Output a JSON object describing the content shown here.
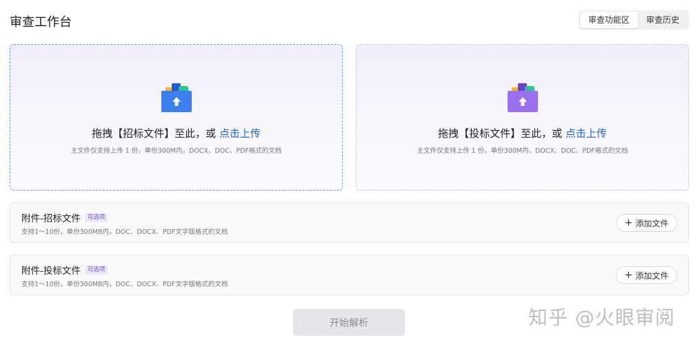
{
  "header": {
    "title": "审查工作台",
    "tabs": [
      {
        "label": "审查功能区",
        "active": true
      },
      {
        "label": "审查历史",
        "active": false
      }
    ]
  },
  "upload_tender": {
    "text_before": "拖拽【招标文件】至此，或 ",
    "link": "点击上传",
    "hint": "主文件仅支持上传 1 份，单份300M内，DOCX、DOC、PDF格式的文档",
    "icon": "folder-upload-blue-icon"
  },
  "upload_bid": {
    "text_before": "拖拽【投标文件】至此，或 ",
    "link": "点击上传",
    "hint": "主文件仅支持上传 1 份，单份300M内，DOCX、DOC、PDF格式的文档",
    "icon": "folder-upload-purple-icon"
  },
  "attachments": [
    {
      "title": "附件-招标文件",
      "badge": "可选项",
      "desc": "支持1～10份，单份300MB内，DOC、DOCX、PDF文字版格式的文档",
      "button": "添加文件"
    },
    {
      "title": "附件-投标文件",
      "badge": "可选项",
      "desc": "支持1～10份，单份300MB内，DOC、DOCX、PDF文字版格式的文档",
      "button": "添加文件"
    }
  ],
  "start_button": "开始解析",
  "watermark": "知乎 @火眼审阅",
  "colors": {
    "accent": "#1f63d6",
    "badge": "#7a4fe0",
    "disabled_button": "#e5e6ea"
  }
}
